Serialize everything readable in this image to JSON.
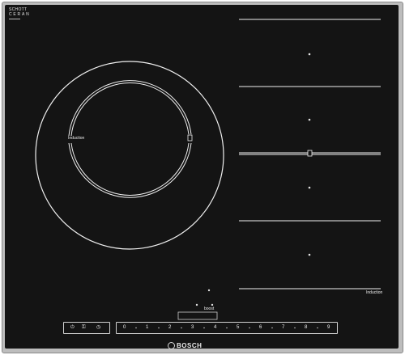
{
  "brand": {
    "glass_maker": "SCHOTT",
    "glass_line": "CERAN",
    "name": "BOSCH"
  },
  "zones": {
    "round_label": "Induction",
    "flex_label": "Induction"
  },
  "controls": {
    "power_level_scale": [
      "0",
      "1",
      "2",
      "3",
      "4",
      "5",
      "6",
      "7",
      "8",
      "9"
    ],
    "boost_label": "boost",
    "timer_label": "Timer"
  },
  "colors": {
    "glass": "#141414",
    "frame": "#bdbdbd",
    "markings": "#f0f0f0"
  }
}
